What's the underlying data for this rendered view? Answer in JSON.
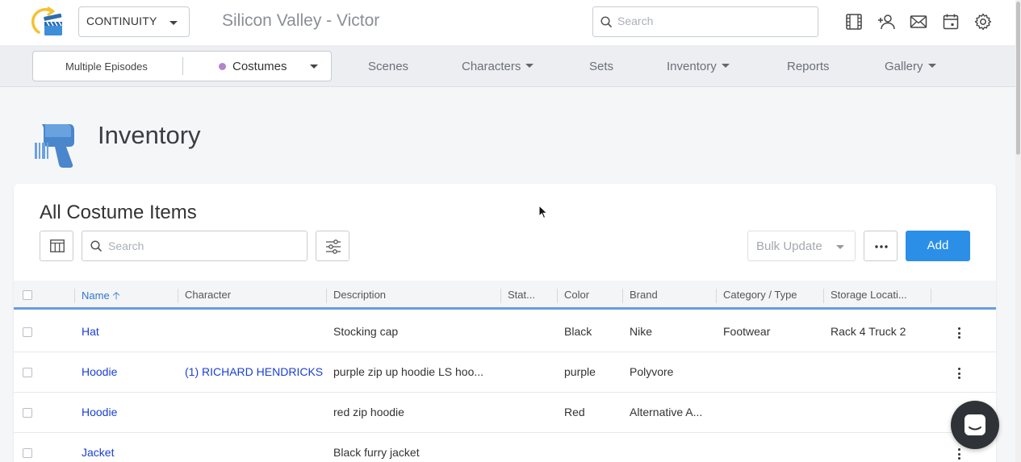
{
  "header": {
    "app_select_label": "CONTINUITY",
    "project_name": "Silicon Valley - Victor",
    "search_placeholder": "Search",
    "icons": [
      "film-icon",
      "add-user-icon",
      "mail-icon",
      "calendar-icon",
      "gear-icon"
    ]
  },
  "nav": {
    "episode_label": "Multiple Episodes",
    "department_label": "Costumes",
    "department_color": "#b085c9",
    "items": [
      {
        "label": "Scenes",
        "dropdown": false
      },
      {
        "label": "Characters",
        "dropdown": true
      },
      {
        "label": "Sets",
        "dropdown": false
      },
      {
        "label": "Inventory",
        "dropdown": true
      },
      {
        "label": "Reports",
        "dropdown": false
      },
      {
        "label": "Gallery",
        "dropdown": true
      }
    ]
  },
  "page": {
    "title": "Inventory"
  },
  "card": {
    "title": "All Costume Items",
    "search_placeholder": "Search",
    "bulk_update_label": "Bulk Update",
    "add_label": "Add",
    "accent_color": "#2b8fe8"
  },
  "table": {
    "columns": [
      "Name",
      "Character",
      "Description",
      "Stat...",
      "Color",
      "Brand",
      "Category / Type",
      "Storage Locati..."
    ],
    "sorted_column": "Name",
    "sort_direction": "ascending",
    "rows": [
      {
        "name": "Hat",
        "character": "",
        "description": "Stocking cap",
        "status": "",
        "color": "Black",
        "brand": "Nike",
        "category": "Footwear",
        "storage": "Rack 4 Truck 2"
      },
      {
        "name": "Hoodie",
        "character": "(1) RICHARD HENDRICKS",
        "description": "purple zip up hoodie LS hoo...",
        "status": "",
        "color": "purple",
        "brand": "Polyvore",
        "category": "",
        "storage": ""
      },
      {
        "name": "Hoodie",
        "character": "",
        "description": "red zip hoodie",
        "status": "",
        "color": "Red",
        "brand": "Alternative A...",
        "category": "",
        "storage": ""
      },
      {
        "name": "Jacket",
        "character": "",
        "description": "Black furry jacket",
        "status": "",
        "color": "",
        "brand": "",
        "category": "",
        "storage": ""
      }
    ]
  }
}
